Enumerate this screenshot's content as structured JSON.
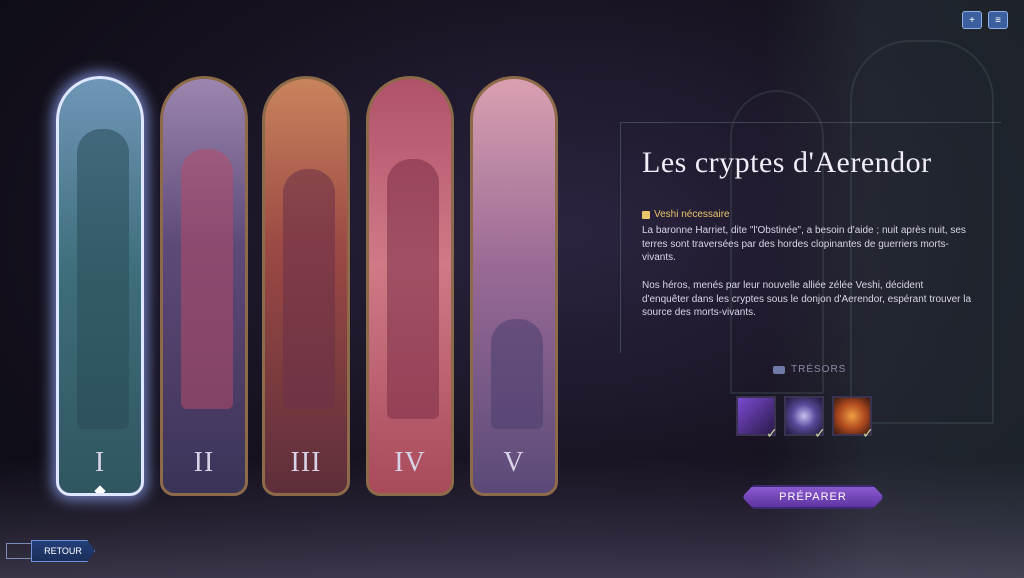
{
  "header": {
    "icons": [
      "add-friend-icon",
      "menu-icon"
    ]
  },
  "chapters": [
    {
      "numeral": "I",
      "selected": true
    },
    {
      "numeral": "II",
      "selected": false
    },
    {
      "numeral": "III",
      "selected": false
    },
    {
      "numeral": "IV",
      "selected": false
    },
    {
      "numeral": "V",
      "selected": false
    }
  ],
  "info": {
    "title": "Les cryptes d'Aerendor",
    "requirement": "Veshi nécessaire",
    "paragraph1": "La baronne Harriet, dite \"l'Obstinée\", a besoin d'aide ; nuit après nuit, ses terres sont traversées par des hordes clopinantes de guerriers morts-vivants.",
    "paragraph2": "Nos héros, menés par leur nouvelle alliée zélée Veshi, décident d'enquêter dans les cryptes sous le donjon d'Aerendor, espérant trouver la source des morts-vivants."
  },
  "treasures": {
    "label": "TRÉSORS",
    "items": [
      {
        "icon": "heroes-icon",
        "acquired": true
      },
      {
        "icon": "orb-icon",
        "acquired": true
      },
      {
        "icon": "fire-figure-icon",
        "acquired": true
      }
    ]
  },
  "buttons": {
    "prepare": "PRÉPARER",
    "back": "RETOUR"
  }
}
